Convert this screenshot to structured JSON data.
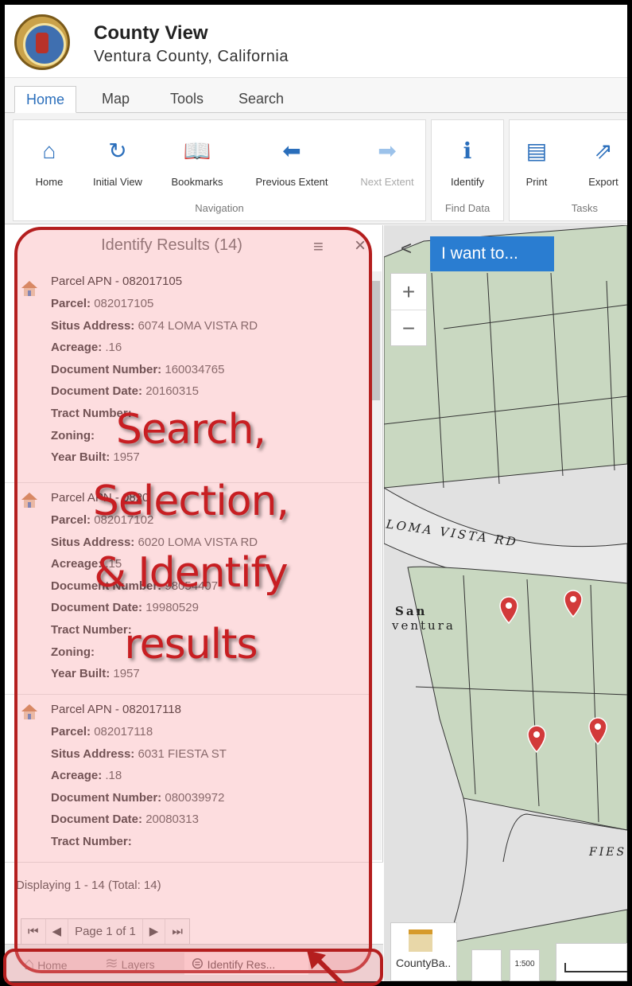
{
  "header": {
    "title": "County View",
    "subtitle": "Ventura County, California",
    "seal_icon": "county-seal"
  },
  "tabs": [
    {
      "label": "Home",
      "active": true
    },
    {
      "label": "Map",
      "active": false
    },
    {
      "label": "Tools",
      "active": false
    },
    {
      "label": "Search",
      "active": false
    }
  ],
  "ribbon": {
    "navigation": {
      "title": "Navigation",
      "buttons": [
        {
          "label": "Home",
          "icon": "house-icon",
          "enabled": true
        },
        {
          "label": "Initial View",
          "icon": "refresh-icon",
          "enabled": true
        },
        {
          "label": "Bookmarks",
          "icon": "book-icon",
          "enabled": true
        },
        {
          "label": "Previous Extent",
          "icon": "arrow-left-icon",
          "enabled": true
        },
        {
          "label": "Next Extent",
          "icon": "arrow-right-icon",
          "enabled": false
        }
      ]
    },
    "find_data": {
      "title": "Find Data",
      "buttons": [
        {
          "label": "Identify",
          "icon": "identify-icon",
          "enabled": true
        }
      ]
    },
    "tasks": {
      "title": "Tasks",
      "buttons": [
        {
          "label": "Print",
          "icon": "printer-icon",
          "enabled": true
        },
        {
          "label": "Export",
          "icon": "export-icon",
          "enabled": true
        }
      ]
    }
  },
  "panel": {
    "title": "Identify Results (14)",
    "results": [
      {
        "heading": "Parcel APN - 082017105",
        "fields": [
          {
            "label": "Parcel:",
            "value": "082017105"
          },
          {
            "label": "Situs Address:",
            "value": "6074 LOMA VISTA RD"
          },
          {
            "label": "Acreage:",
            "value": ".16"
          },
          {
            "label": "Document Number:",
            "value": "160034765"
          },
          {
            "label": "Document Date:",
            "value": "20160315"
          },
          {
            "label": "Tract Number:",
            "value": ""
          },
          {
            "label": "Zoning:",
            "value": ""
          },
          {
            "label": "Year Built:",
            "value": "1957"
          }
        ]
      },
      {
        "heading": "Parcel APN - 0820",
        "fields": [
          {
            "label": "Parcel:",
            "value": "082017102"
          },
          {
            "label": "Situs Address:",
            "value": "6020 LOMA VISTA RD"
          },
          {
            "label": "Acreage:",
            "value": ".15"
          },
          {
            "label": "Document Number:",
            "value": "98054407"
          },
          {
            "label": "Document Date:",
            "value": "19980529"
          },
          {
            "label": "Tract Number:",
            "value": ""
          },
          {
            "label": "Zoning:",
            "value": ""
          },
          {
            "label": "Year Built:",
            "value": "1957"
          }
        ]
      },
      {
        "heading": "Parcel APN - 082017118",
        "fields": [
          {
            "label": "Parcel:",
            "value": "082017118"
          },
          {
            "label": "Situs Address:",
            "value": "6031 FIESTA ST"
          },
          {
            "label": "Acreage:",
            "value": ".18"
          },
          {
            "label": "Document Number:",
            "value": "080039972"
          },
          {
            "label": "Document Date:",
            "value": "20080313"
          },
          {
            "label": "Tract Number:",
            "value": ""
          }
        ]
      }
    ],
    "count_text": "Displaying 1 - 14 (Total: 14)",
    "pager": {
      "first": "⏮",
      "prev": "◀",
      "page_text": "Page 1 of 1",
      "next": "▶",
      "last": "⏭"
    }
  },
  "bottom_bar": {
    "items": [
      {
        "label": "Home",
        "icon": "house-icon",
        "active": false
      },
      {
        "label": "Layers",
        "icon": "layers-icon",
        "active": false
      },
      {
        "label": "Identify Res...",
        "icon": "identify-list-icon",
        "active": true
      }
    ]
  },
  "map": {
    "i_want_to": "I want to...",
    "zoom_in": "+",
    "zoom_out": "−",
    "collapse": "<",
    "street_loma": "LOMA VISTA RD",
    "street_fiesta": "FIES",
    "area_name_1": "San",
    "area_name_2": "ventura",
    "basemap_label": "CountyBa..",
    "scale_label": "1:500"
  },
  "annotation": {
    "callout_lines": [
      "Search,",
      "Selection,",
      "& Identify",
      "results"
    ],
    "highlight_color": "#b41e1e"
  }
}
